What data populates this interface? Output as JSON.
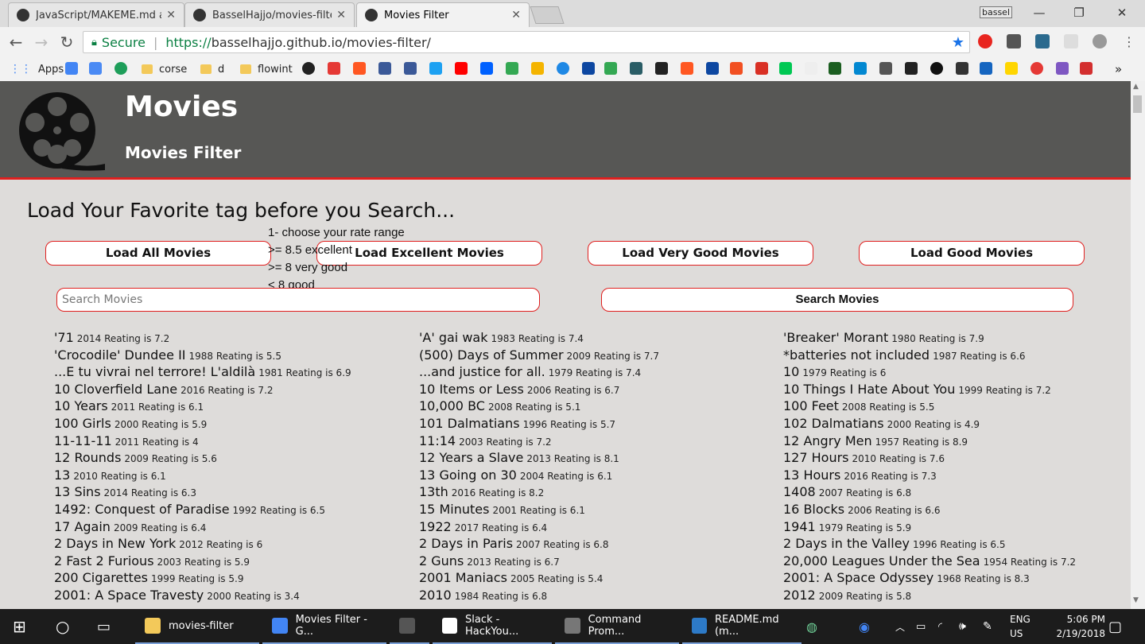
{
  "browser": {
    "tabs": [
      {
        "label": "JavaScript/MAKEME.md at",
        "active": false
      },
      {
        "label": "BasselHajjo/movies-filter",
        "active": false
      },
      {
        "label": "Movies Filter",
        "active": true
      }
    ],
    "user_label": "bassel",
    "secure_label": "Secure",
    "url_scheme": "https://",
    "url_rest": "basselhajjo.github.io/movies-filter/",
    "bookmarks": [
      {
        "label": "Apps"
      },
      {
        "label": "corse"
      },
      {
        "label": "d"
      },
      {
        "label": "flowint"
      }
    ],
    "more": "»"
  },
  "site": {
    "title": "Movies",
    "subtitle": "Movies Filter",
    "heading": "Load Your Favorite tag before you Search...",
    "buttons": [
      "Load All Movies",
      "Load Excellent Movies",
      "Load Very Good Movies",
      "Load Good Movies"
    ],
    "rate_note": [
      "1- choose your rate range",
      ">= 8.5 excellent",
      ">= 8 very good",
      "< 8 good"
    ],
    "search_placeholder": "Search Movies",
    "search_button": "Search Movies"
  },
  "movies": [
    [
      {
        "title": "'71",
        "meta": "2014 Reating is 7.2"
      },
      {
        "title": "'Crocodile' Dundee II",
        "meta": "1988 Reating is 5.5"
      },
      {
        "title": "...E tu vivrai nel terrore! L'aldilà",
        "meta": "1981 Reating is 6.9"
      },
      {
        "title": "10 Cloverfield Lane",
        "meta": "2016 Reating is 7.2"
      },
      {
        "title": "10 Years",
        "meta": "2011 Reating is 6.1"
      },
      {
        "title": "100 Girls",
        "meta": "2000 Reating is 5.9"
      },
      {
        "title": "11-11-11",
        "meta": "2011 Reating is 4"
      },
      {
        "title": "12 Rounds",
        "meta": "2009 Reating is 5.6"
      },
      {
        "title": "13",
        "meta": "2010 Reating is 6.1"
      },
      {
        "title": "13 Sins",
        "meta": "2014 Reating is 6.3"
      },
      {
        "title": "1492: Conquest of Paradise",
        "meta": "1992 Reating is 6.5"
      },
      {
        "title": "17 Again",
        "meta": "2009 Reating is 6.4"
      },
      {
        "title": "2 Days in New York",
        "meta": "2012 Reating is 6"
      },
      {
        "title": "2 Fast 2 Furious",
        "meta": "2003 Reating is 5.9"
      },
      {
        "title": "200 Cigarettes",
        "meta": "1999 Reating is 5.9"
      },
      {
        "title": "2001: A Space Travesty",
        "meta": "2000 Reating is 3.4"
      }
    ],
    [
      {
        "title": "'A' gai wak",
        "meta": "1983 Reating is 7.4"
      },
      {
        "title": "(500) Days of Summer",
        "meta": "2009 Reating is 7.7"
      },
      {
        "title": "...and justice for all.",
        "meta": "1979 Reating is 7.4"
      },
      {
        "title": "10 Items or Less",
        "meta": "2006 Reating is 6.7"
      },
      {
        "title": "10,000 BC",
        "meta": "2008 Reating is 5.1"
      },
      {
        "title": "101 Dalmatians",
        "meta": "1996 Reating is 5.7"
      },
      {
        "title": "11:14",
        "meta": "2003 Reating is 7.2"
      },
      {
        "title": "12 Years a Slave",
        "meta": "2013 Reating is 8.1"
      },
      {
        "title": "13 Going on 30",
        "meta": "2004 Reating is 6.1"
      },
      {
        "title": "13th",
        "meta": "2016 Reating is 8.2"
      },
      {
        "title": "15 Minutes",
        "meta": "2001 Reating is 6.1"
      },
      {
        "title": "1922",
        "meta": "2017 Reating is 6.4"
      },
      {
        "title": "2 Days in Paris",
        "meta": "2007 Reating is 6.8"
      },
      {
        "title": "2 Guns",
        "meta": "2013 Reating is 6.7"
      },
      {
        "title": "2001 Maniacs",
        "meta": "2005 Reating is 5.4"
      },
      {
        "title": "2010",
        "meta": "1984 Reating is 6.8"
      }
    ],
    [
      {
        "title": "'Breaker' Morant",
        "meta": "1980 Reating is 7.9"
      },
      {
        "title": "*batteries not included",
        "meta": "1987 Reating is 6.6"
      },
      {
        "title": "10",
        "meta": "1979 Reating is 6"
      },
      {
        "title": "10 Things I Hate About You",
        "meta": "1999 Reating is 7.2"
      },
      {
        "title": "100 Feet",
        "meta": "2008 Reating is 5.5"
      },
      {
        "title": "102 Dalmatians",
        "meta": "2000 Reating is 4.9"
      },
      {
        "title": "12 Angry Men",
        "meta": "1957 Reating is 8.9"
      },
      {
        "title": "127 Hours",
        "meta": "2010 Reating is 7.6"
      },
      {
        "title": "13 Hours",
        "meta": "2016 Reating is 7.3"
      },
      {
        "title": "1408",
        "meta": "2007 Reating is 6.8"
      },
      {
        "title": "16 Blocks",
        "meta": "2006 Reating is 6.6"
      },
      {
        "title": "1941",
        "meta": "1979 Reating is 5.9"
      },
      {
        "title": "2 Days in the Valley",
        "meta": "1996 Reating is 6.5"
      },
      {
        "title": "20,000 Leagues Under the Sea",
        "meta": "1954 Reating is 7.2"
      },
      {
        "title": "2001: A Space Odyssey",
        "meta": "1968 Reating is 8.3"
      },
      {
        "title": "2012",
        "meta": "2009 Reating is 5.8"
      }
    ]
  ],
  "taskbar": {
    "apps": [
      {
        "label": "movies-filter",
        "icon": "folder-icon",
        "color": "#f3c95a"
      },
      {
        "label": "Movies Filter - G...",
        "icon": "chrome-icon",
        "color": "#4285f4"
      },
      {
        "label": "",
        "icon": "terminal-icon",
        "color": "#555555"
      },
      {
        "label": "Slack - HackYou...",
        "icon": "slack-icon",
        "color": "#ffffff"
      },
      {
        "label": "Command Prom...",
        "icon": "cmd-icon",
        "color": "#777777"
      },
      {
        "label": "README.md (m...",
        "icon": "editor-icon",
        "color": "#2d7ac7"
      }
    ],
    "lang_line1": "ENG",
    "lang_line2": "US",
    "time": "5:06 PM",
    "date": "2/19/2018"
  }
}
